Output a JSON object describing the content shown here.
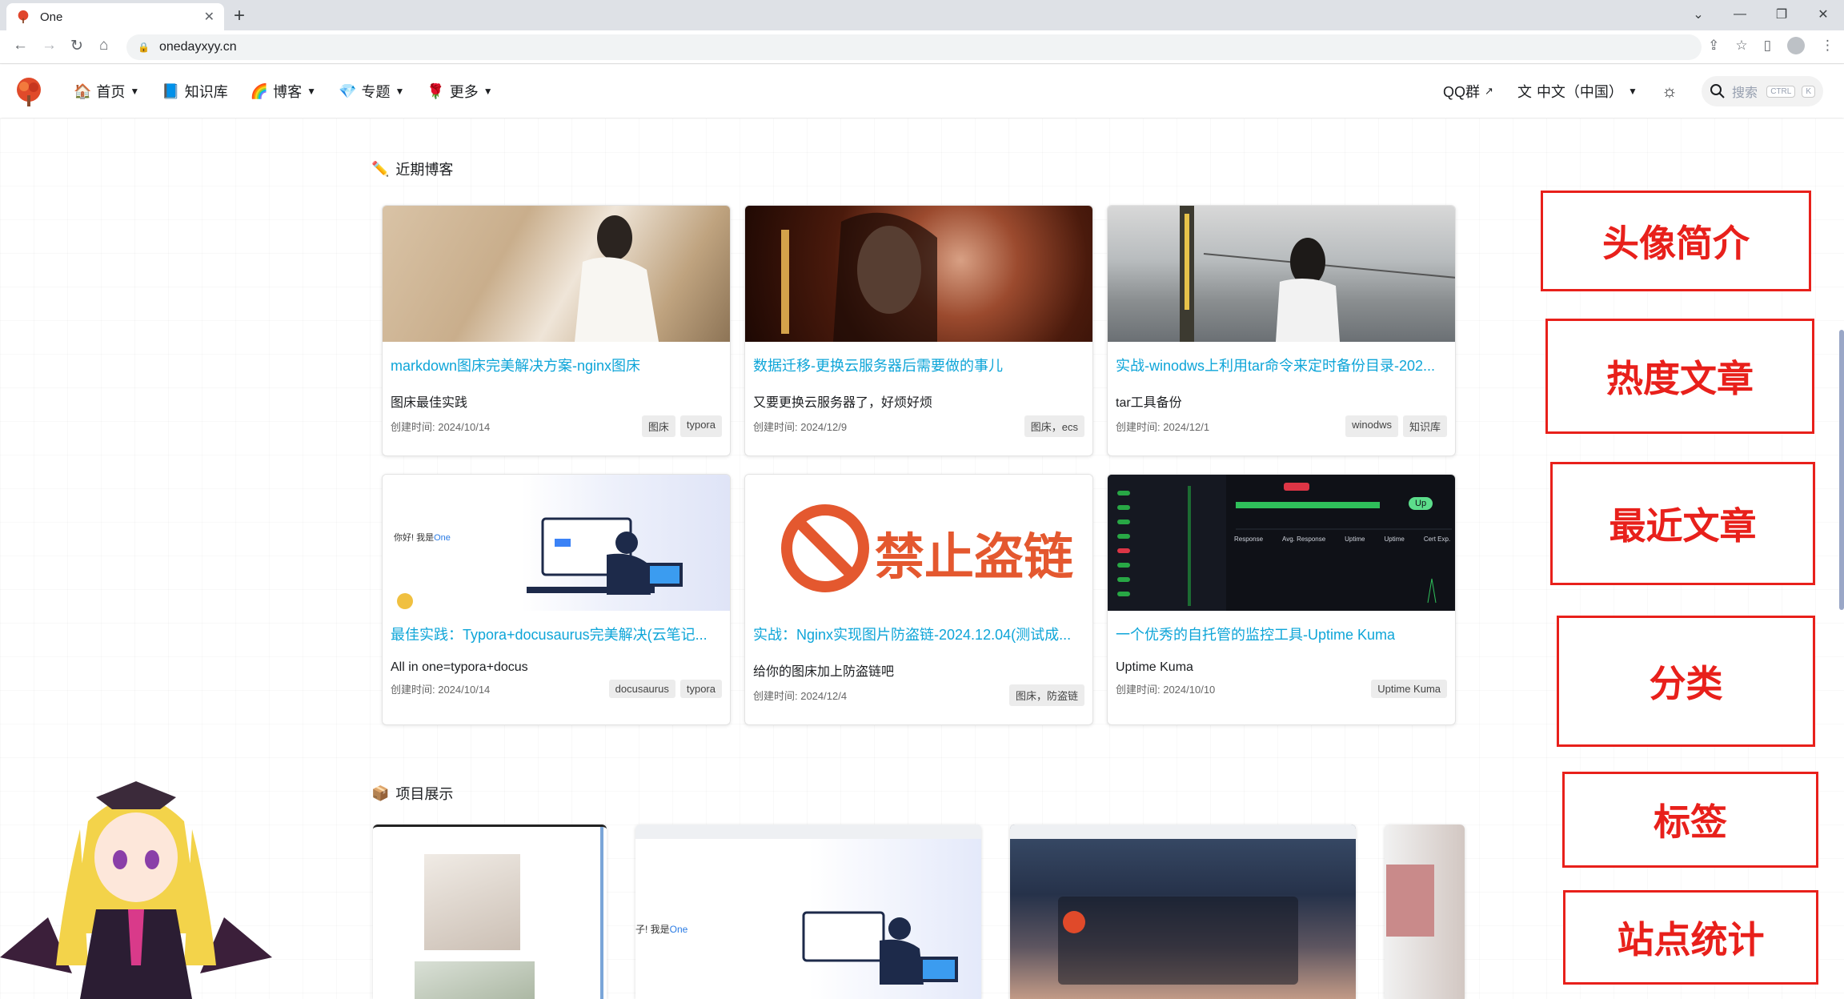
{
  "browser": {
    "tab_title": "One",
    "url": "onedayxyy.cn"
  },
  "nav": {
    "items": [
      {
        "label": "首页",
        "icon": "home-icon"
      },
      {
        "label": "知识库",
        "icon": "book-icon"
      },
      {
        "label": "博客",
        "icon": "rainbow-icon"
      },
      {
        "label": "专题",
        "icon": "gem-icon"
      },
      {
        "label": "更多",
        "icon": "rose-icon"
      }
    ],
    "qq_label": "QQ群",
    "lang_label": "中文（中国）",
    "search_placeholder": "搜索",
    "kbd_ctrl": "CTRL",
    "kbd_k": "K"
  },
  "blog": {
    "section_title": "近期博客",
    "cards": [
      {
        "title": "markdown图床完美解决方案-nginx图床",
        "desc": "图床最佳实践",
        "date": "创建时间: 2024/10/14",
        "tags": [
          "图床",
          "typora"
        ]
      },
      {
        "title": "数据迁移-更换云服务器后需要做的事儿",
        "desc": "又要更换云服务器了，好烦好烦",
        "date": "创建时间: 2024/12/9",
        "tags": [
          "图床，ecs"
        ]
      },
      {
        "title": "实战-winodws上利用tar命令来定时备份目录-202...",
        "desc": "tar工具备份",
        "date": "创建时间: 2024/12/1",
        "tags": [
          "winodws",
          "知识库"
        ]
      },
      {
        "title": "最佳实践：Typora+docusaurus完美解决(云笔记...",
        "desc": "All in one=typora+docus",
        "date": "创建时间: 2024/10/14",
        "tags": [
          "docusaurus",
          "typora"
        ]
      },
      {
        "title": "实战：Nginx实现图片防盗链-2024.12.04(测试成...",
        "desc": "给你的图床加上防盗链吧",
        "date": "创建时间: 2024/12/4",
        "tags": [
          "图床，防盗链"
        ]
      },
      {
        "title": "一个优秀的自托管的监控工具-Uptime Kuma",
        "desc": "Uptime Kuma",
        "date": "创建时间: 2024/10/10",
        "tags": [
          "Uptime Kuma"
        ]
      }
    ],
    "card4_hello": "你好! 我是",
    "card4_name": "One",
    "card5_banner": "禁止盗链",
    "card6_status": "Up",
    "card6_cols": [
      "Response",
      "Avg. Response",
      "Uptime",
      "Uptime",
      "Cert Exp."
    ]
  },
  "projects": {
    "section_title": "项目展示",
    "proj2_hello": "子! 我是",
    "proj2_name": "One"
  },
  "annotations": [
    "头像简介",
    "热度文章",
    "最近文章",
    "分类",
    "标签",
    "站点统计"
  ]
}
